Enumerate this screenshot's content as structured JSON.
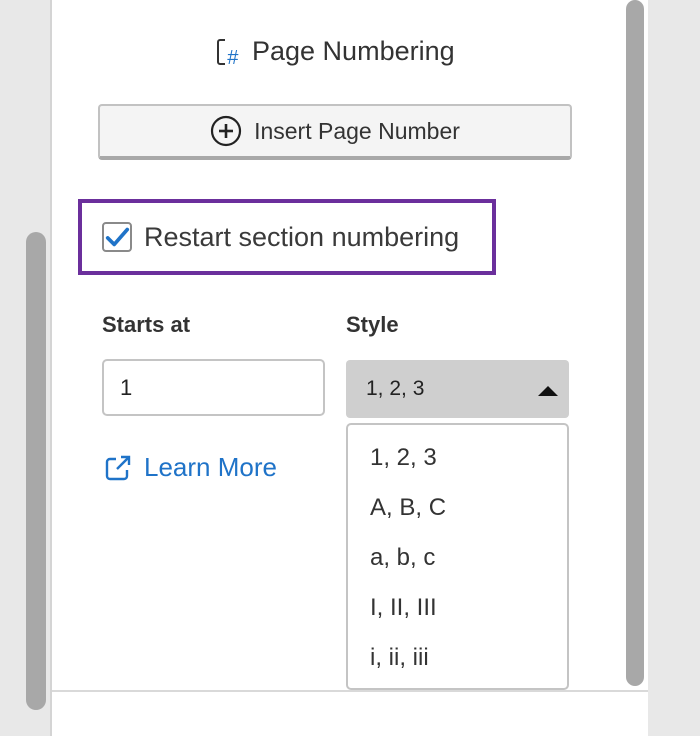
{
  "section": {
    "title": "Page Numbering",
    "icon": "page-hash-icon"
  },
  "insert_button": {
    "label": "Insert Page Number",
    "icon": "plus-circle-icon"
  },
  "restart": {
    "label": "Restart section numbering",
    "checked": true
  },
  "starts_at": {
    "label": "Starts at",
    "value": "1"
  },
  "style": {
    "label": "Style",
    "selected": "1, 2, 3",
    "options": [
      "1, 2, 3",
      "A, B, C",
      "a, b, c",
      "I, II, III",
      "i, ii, iii"
    ]
  },
  "learn_more": {
    "label": "Learn More",
    "icon": "external-link-icon"
  },
  "colors": {
    "accent": "#1f73c8",
    "highlight": "#6b2f9c",
    "check": "#1f73c8"
  }
}
